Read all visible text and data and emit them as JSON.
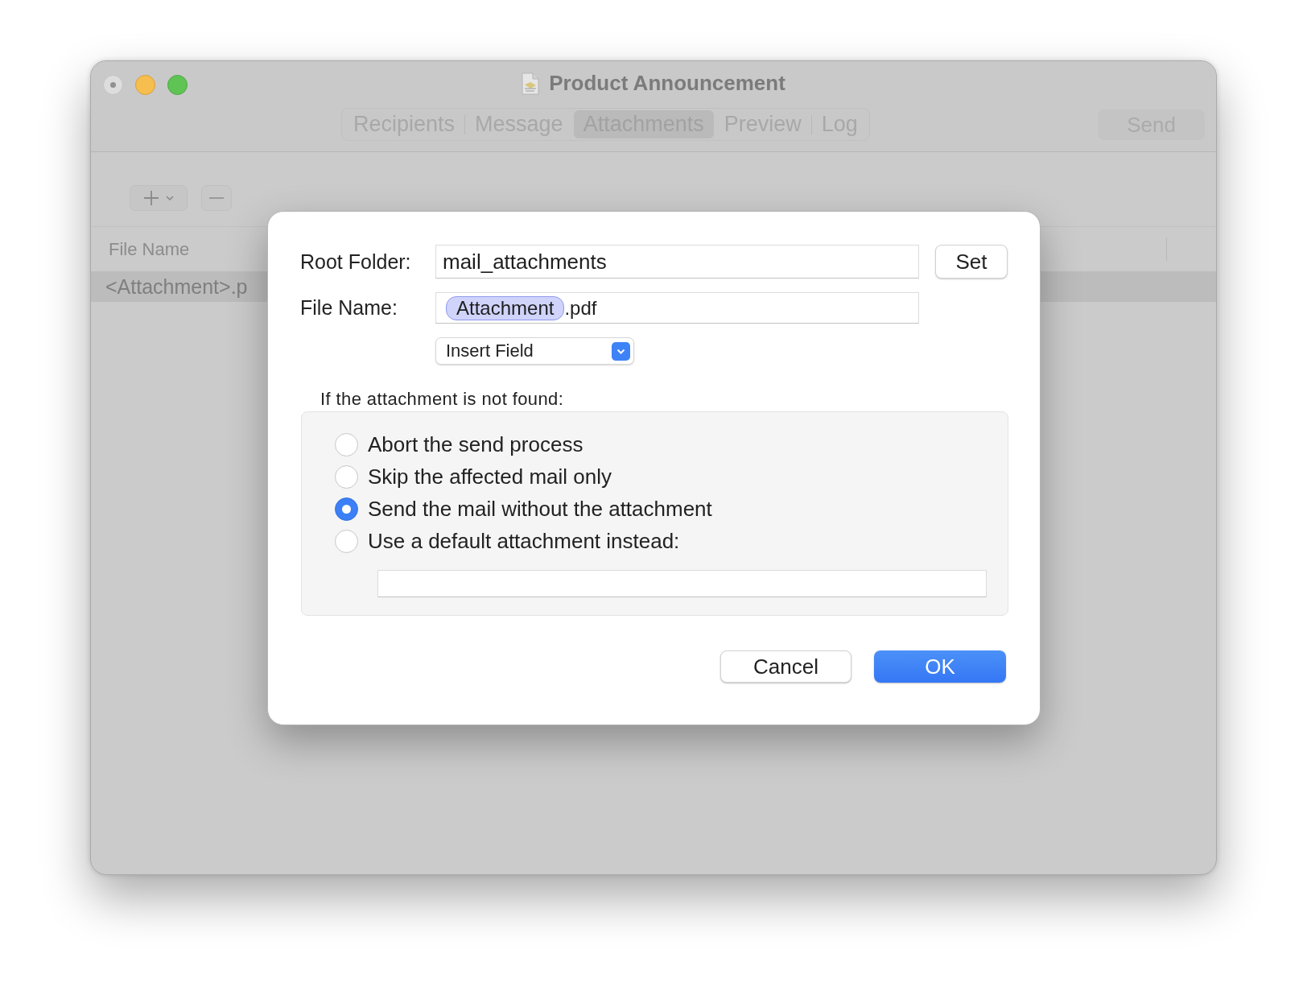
{
  "window": {
    "title": "Product Announcement"
  },
  "tabs": [
    {
      "label": "Recipients",
      "selected": false
    },
    {
      "label": "Message",
      "selected": false
    },
    {
      "label": "Attachments",
      "selected": true
    },
    {
      "label": "Preview",
      "selected": false
    },
    {
      "label": "Log",
      "selected": false
    }
  ],
  "toolbar": {
    "send_button": "Send"
  },
  "table": {
    "columns": [
      "File Name"
    ],
    "rows": [
      {
        "cells": [
          "<Attachment>.p"
        ],
        "selected": true
      }
    ]
  },
  "dialog": {
    "root_folder": {
      "label": "Root Folder:",
      "value": "mail_attachments",
      "button": "Set"
    },
    "file_name": {
      "label": "File Name:",
      "token": "Attachment",
      "suffix": ".pdf"
    },
    "insert_field": {
      "label": "Insert Field"
    },
    "not_found": {
      "label": "If the attachment is not found:",
      "options": [
        {
          "label": "Abort the send process",
          "selected": false
        },
        {
          "label": "Skip the affected mail only",
          "selected": false
        },
        {
          "label": "Send the mail without the attachment",
          "selected": true
        },
        {
          "label": "Use a default attachment instead:",
          "selected": false
        }
      ]
    },
    "buttons": [
      {
        "label": "Cancel",
        "kind": "secondary"
      },
      {
        "label": "OK",
        "kind": "primary"
      }
    ]
  }
}
